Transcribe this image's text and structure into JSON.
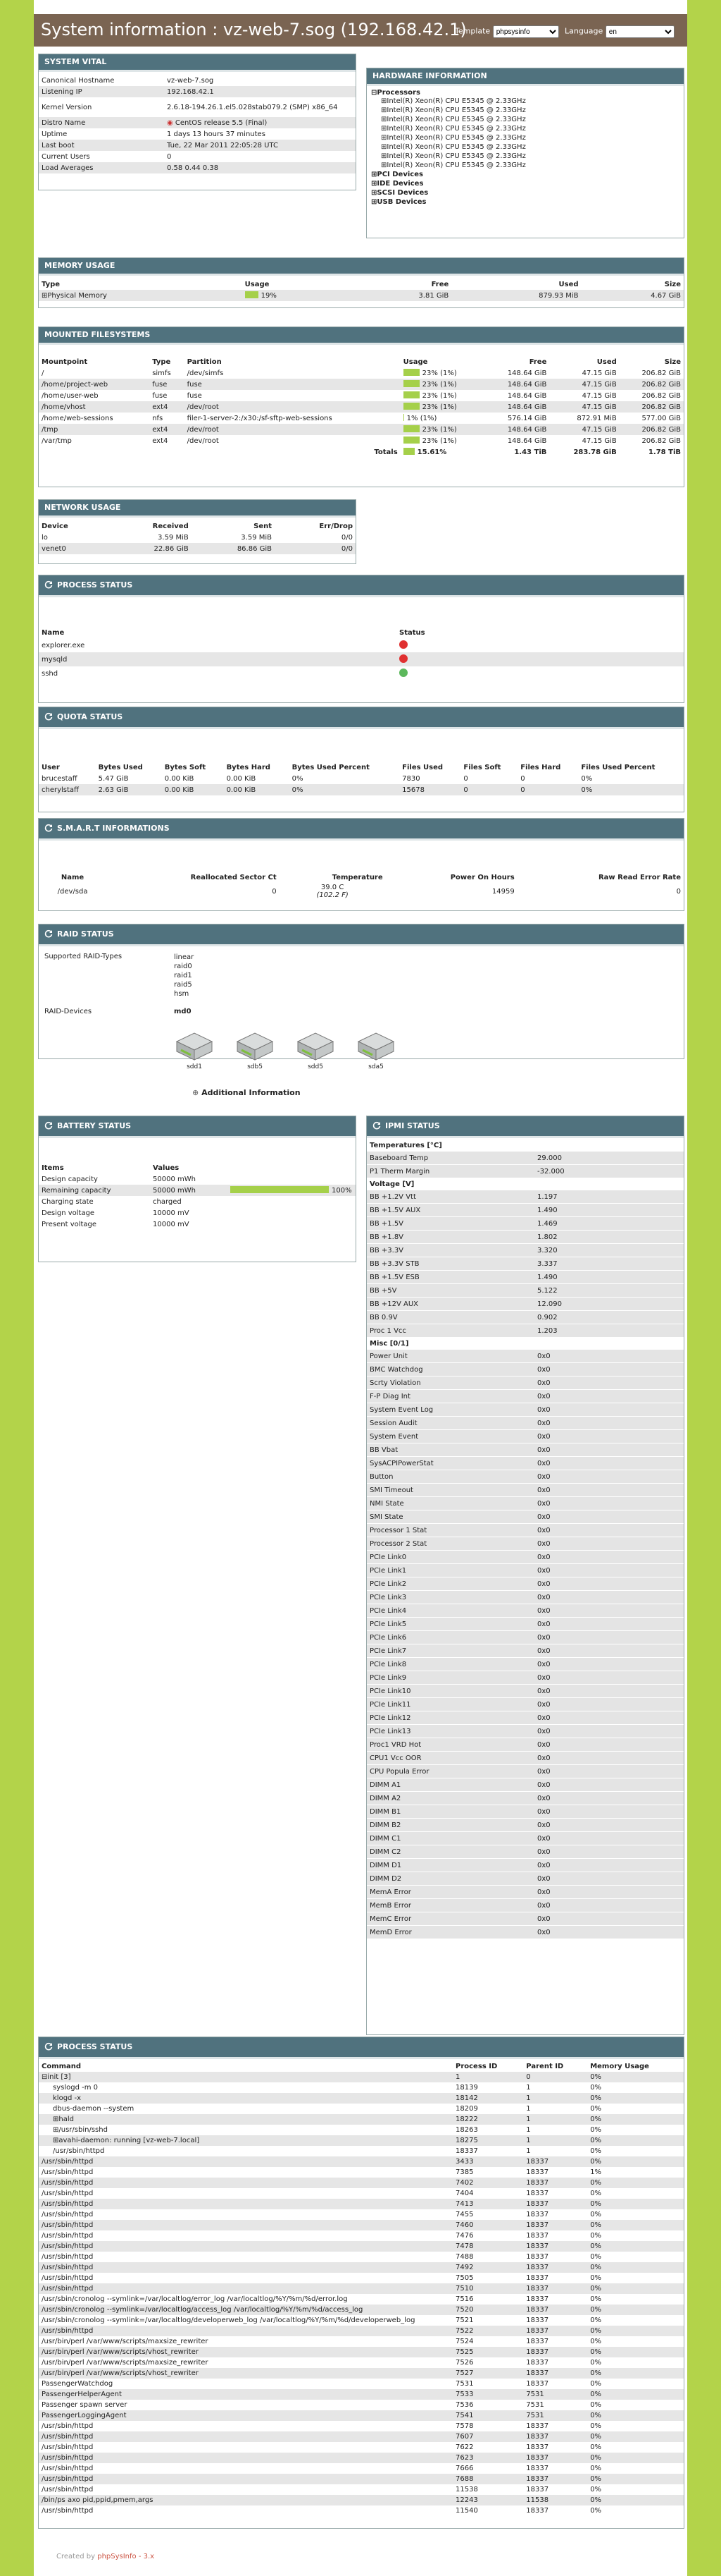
{
  "header": {
    "title": "System information : vz-web-7.sog (192.168.42.1)",
    "template_label": "Template",
    "template_value": "phpsysinfo",
    "language_label": "Language",
    "language_value": "en"
  },
  "vital": {
    "title": "SYSTEM VITAL",
    "rows": [
      [
        "Canonical Hostname",
        "vz-web-7.sog"
      ],
      [
        "Listening IP",
        "192.168.42.1"
      ],
      [
        "Kernel Version",
        "2.6.18-194.26.1.el5.028stab079.2 (SMP) x86_64"
      ],
      [
        "Distro Name",
        "CentOS release 5.5 (Final)"
      ],
      [
        "Uptime",
        "1 days 13 hours 37 minutes"
      ],
      [
        "Last boot",
        "Tue, 22 Mar 2011 22:05:28 UTC"
      ],
      [
        "Current Users",
        "0"
      ],
      [
        "Load Averages",
        "0.58 0.44 0.38"
      ]
    ]
  },
  "hardware": {
    "title": "HARDWARE INFORMATION",
    "processors_label": "Processors",
    "cpus": [
      "Intel(R) Xeon(R) CPU E5345 @ 2.33GHz",
      "Intel(R) Xeon(R) CPU E5345 @ 2.33GHz",
      "Intel(R) Xeon(R) CPU E5345 @ 2.33GHz",
      "Intel(R) Xeon(R) CPU E5345 @ 2.33GHz",
      "Intel(R) Xeon(R) CPU E5345 @ 2.33GHz",
      "Intel(R) Xeon(R) CPU E5345 @ 2.33GHz",
      "Intel(R) Xeon(R) CPU E5345 @ 2.33GHz",
      "Intel(R) Xeon(R) CPU E5345 @ 2.33GHz"
    ],
    "buses": [
      "PCI Devices",
      "IDE Devices",
      "SCSI Devices",
      "USB Devices"
    ]
  },
  "memory": {
    "title": "MEMORY USAGE",
    "headers": [
      "Type",
      "Usage",
      "Free",
      "Used",
      "Size"
    ],
    "row": [
      "Physical Memory",
      "19%",
      "3.81 GiB",
      "879.93 MiB",
      "4.67 GiB"
    ],
    "pct": 0.19
  },
  "filesystems": {
    "title": "MOUNTED FILESYSTEMS",
    "headers": [
      "Mountpoint",
      "Type",
      "Partition",
      "Usage",
      "Free",
      "Used",
      "Size"
    ],
    "rows": [
      [
        "/",
        "simfs",
        "/dev/simfs",
        "23% (1%)",
        "148.64 GiB",
        "47.15 GiB",
        "206.82 GiB"
      ],
      [
        "/home/project-web",
        "fuse",
        "fuse",
        "23% (1%)",
        "148.64 GiB",
        "47.15 GiB",
        "206.82 GiB"
      ],
      [
        "/home/user-web",
        "fuse",
        "fuse",
        "23% (1%)",
        "148.64 GiB",
        "47.15 GiB",
        "206.82 GiB"
      ],
      [
        "/home/vhost",
        "ext4",
        "/dev/root",
        "23% (1%)",
        "148.64 GiB",
        "47.15 GiB",
        "206.82 GiB"
      ],
      [
        "/home/web-sessions",
        "nfs",
        "filer-1-server-2:/x30:/sf-sftp-web-sessions",
        "1% (1%)",
        "576.14 GiB",
        "872.91 MiB",
        "577.00 GiB"
      ],
      [
        "/tmp",
        "ext4",
        "/dev/root",
        "23% (1%)",
        "148.64 GiB",
        "47.15 GiB",
        "206.82 GiB"
      ],
      [
        "/var/tmp",
        "ext4",
        "/dev/root",
        "23% (1%)",
        "148.64 GiB",
        "47.15 GiB",
        "206.82 GiB"
      ]
    ],
    "pcts": [
      0.23,
      0.23,
      0.23,
      0.23,
      0.01,
      0.23,
      0.23
    ],
    "totals": [
      "Totals",
      "15.61%",
      "1.43 TiB",
      "283.78 GiB",
      "1.78 TiB"
    ],
    "total_pct": 0.156
  },
  "network": {
    "title": "NETWORK USAGE",
    "headers": [
      "Device",
      "Received",
      "Sent",
      "Err/Drop"
    ],
    "rows": [
      [
        "lo",
        "3.59 MiB",
        "3.59 MiB",
        "0/0"
      ],
      [
        "venet0",
        "22.86 GiB",
        "86.86 GiB",
        "0/0"
      ]
    ]
  },
  "process_status": {
    "title": "PROCESS STATUS",
    "headers": [
      "Name",
      "Status"
    ],
    "rows": [
      {
        "name": "explorer.exe",
        "color": "#e03030"
      },
      {
        "name": "mysqld",
        "color": "#e03030"
      },
      {
        "name": "sshd",
        "color": "#5cb85c"
      }
    ]
  },
  "quota": {
    "title": "QUOTA STATUS",
    "headers": [
      "User",
      "Bytes Used",
      "Bytes Soft",
      "Bytes Hard",
      "Bytes Used Percent",
      "Files Used",
      "Files Soft",
      "Files Hard",
      "Files Used Percent"
    ],
    "rows": [
      [
        "brucestaff",
        "5.47 GiB",
        "0.00 KiB",
        "0.00 KiB",
        "0%",
        "7830",
        "0",
        "0",
        "0%"
      ],
      [
        "cherylstaff",
        "2.63 GiB",
        "0.00 KiB",
        "0.00 KiB",
        "0%",
        "15678",
        "0",
        "0",
        "0%"
      ]
    ]
  },
  "smart": {
    "title": "S.M.A.R.T INFORMATIONS",
    "headers": [
      "Name",
      "Reallocated Sector Ct",
      "Temperature",
      "Power On Hours",
      "Raw Read Error Rate"
    ],
    "row": [
      "/dev/sda",
      "0",
      "39.0 C",
      "14959",
      "0"
    ],
    "temp_f": "(102.2 F)"
  },
  "raid": {
    "title": "RAID STATUS",
    "types_label": "Supported RAID-Types",
    "types": [
      "linear",
      "raid0",
      "raid1",
      "raid5",
      "hsm"
    ],
    "devices_label": "RAID-Devices",
    "device": "md0",
    "drives": [
      "sdd1",
      "sdb5",
      "sdd5",
      "sda5"
    ],
    "additional": "Additional Information"
  },
  "battery": {
    "title": "BATTERY STATUS",
    "headers": [
      "Items",
      "Values"
    ],
    "rows": [
      [
        "Design capacity",
        "50000 mWh"
      ],
      [
        "Remaining capacity",
        "50000 mWh"
      ],
      [
        "Charging state",
        "charged"
      ],
      [
        "Design voltage",
        "10000 mV"
      ],
      [
        "Present voltage",
        "10000 mV"
      ]
    ],
    "remaining_pct": "100%",
    "remaining_frac": 1.0
  },
  "ipmi": {
    "title": "IPMI STATUS",
    "sections": [
      {
        "name": "Temperatures [°C]",
        "rows": [
          [
            "Baseboard Temp",
            "29.000"
          ],
          [
            "P1 Therm Margin",
            "-32.000"
          ]
        ]
      },
      {
        "name": "Voltage [V]",
        "rows": [
          [
            "BB +1.2V Vtt",
            "1.197"
          ],
          [
            "BB +1.5V AUX",
            "1.490"
          ],
          [
            "BB +1.5V",
            "1.469"
          ],
          [
            "BB +1.8V",
            "1.802"
          ],
          [
            "BB +3.3V",
            "3.320"
          ],
          [
            "BB +3.3V STB",
            "3.337"
          ],
          [
            "BB +1.5V ESB",
            "1.490"
          ],
          [
            "BB +5V",
            "5.122"
          ],
          [
            "BB +12V AUX",
            "12.090"
          ],
          [
            "BB 0.9V",
            "0.902"
          ],
          [
            "Proc 1 Vcc",
            "1.203"
          ]
        ]
      },
      {
        "name": "Misc [0/1]",
        "rows": [
          [
            "Power Unit",
            "0x0"
          ],
          [
            "BMC Watchdog",
            "0x0"
          ],
          [
            "Scrty Violation",
            "0x0"
          ],
          [
            "F-P Diag Int",
            "0x0"
          ],
          [
            "System Event Log",
            "0x0"
          ],
          [
            "Session Audit",
            "0x0"
          ],
          [
            "System Event",
            "0x0"
          ],
          [
            "BB Vbat",
            "0x0"
          ],
          [
            "SysACPIPowerStat",
            "0x0"
          ],
          [
            "Button",
            "0x0"
          ],
          [
            "SMI Timeout",
            "0x0"
          ],
          [
            "NMI State",
            "0x0"
          ],
          [
            "SMI State",
            "0x0"
          ],
          [
            "Processor 1 Stat",
            "0x0"
          ],
          [
            "Processor 2 Stat",
            "0x0"
          ],
          [
            "PCIe Link0",
            "0x0"
          ],
          [
            "PCIe Link1",
            "0x0"
          ],
          [
            "PCIe Link2",
            "0x0"
          ],
          [
            "PCIe Link3",
            "0x0"
          ],
          [
            "PCIe Link4",
            "0x0"
          ],
          [
            "PCIe Link5",
            "0x0"
          ],
          [
            "PCIe Link6",
            "0x0"
          ],
          [
            "PCIe Link7",
            "0x0"
          ],
          [
            "PCIe Link8",
            "0x0"
          ],
          [
            "PCIe Link9",
            "0x0"
          ],
          [
            "PCIe Link10",
            "0x0"
          ],
          [
            "PCIe Link11",
            "0x0"
          ],
          [
            "PCIe Link12",
            "0x0"
          ],
          [
            "PCIe Link13",
            "0x0"
          ],
          [
            "Proc1 VRD Hot",
            "0x0"
          ],
          [
            "CPU1 Vcc OOR",
            "0x0"
          ],
          [
            "CPU Popula Error",
            "0x0"
          ],
          [
            "DIMM A1",
            "0x0"
          ],
          [
            "DIMM A2",
            "0x0"
          ],
          [
            "DIMM B1",
            "0x0"
          ],
          [
            "DIMM B2",
            "0x0"
          ],
          [
            "DIMM C1",
            "0x0"
          ],
          [
            "DIMM C2",
            "0x0"
          ],
          [
            "DIMM D1",
            "0x0"
          ],
          [
            "DIMM D2",
            "0x0"
          ],
          [
            "MemA Error",
            "0x0"
          ],
          [
            "MemB Error",
            "0x0"
          ],
          [
            "MemC Error",
            "0x0"
          ],
          [
            "MemD Error",
            "0x0"
          ]
        ]
      }
    ]
  },
  "processes": {
    "title": "PROCESS STATUS",
    "headers": [
      "Command",
      "Process ID",
      "Parent ID",
      "Memory Usage"
    ],
    "rows": [
      [
        "init [3]",
        "1",
        "0",
        "0%"
      ],
      [
        "syslogd -m 0",
        "18139",
        "1",
        "0%"
      ],
      [
        "klogd -x",
        "18142",
        "1",
        "0%"
      ],
      [
        "dbus-daemon --system",
        "18209",
        "1",
        "0%"
      ],
      [
        "hald",
        "18222",
        "1",
        "0%"
      ],
      [
        "/usr/sbin/sshd",
        "18263",
        "1",
        "0%"
      ],
      [
        "avahi-daemon: running [vz-web-7.local]",
        "18275",
        "1",
        "0%"
      ],
      [
        "/usr/sbin/httpd",
        "18337",
        "1",
        "0%"
      ],
      [
        "/usr/sbin/httpd",
        "3433",
        "18337",
        "0%"
      ],
      [
        "/usr/sbin/httpd",
        "7385",
        "18337",
        "1%"
      ],
      [
        "/usr/sbin/httpd",
        "7402",
        "18337",
        "0%"
      ],
      [
        "/usr/sbin/httpd",
        "7404",
        "18337",
        "0%"
      ],
      [
        "/usr/sbin/httpd",
        "7413",
        "18337",
        "0%"
      ],
      [
        "/usr/sbin/httpd",
        "7455",
        "18337",
        "0%"
      ],
      [
        "/usr/sbin/httpd",
        "7460",
        "18337",
        "0%"
      ],
      [
        "/usr/sbin/httpd",
        "7476",
        "18337",
        "0%"
      ],
      [
        "/usr/sbin/httpd",
        "7478",
        "18337",
        "0%"
      ],
      [
        "/usr/sbin/httpd",
        "7488",
        "18337",
        "0%"
      ],
      [
        "/usr/sbin/httpd",
        "7492",
        "18337",
        "0%"
      ],
      [
        "/usr/sbin/httpd",
        "7505",
        "18337",
        "0%"
      ],
      [
        "/usr/sbin/httpd",
        "7510",
        "18337",
        "0%"
      ],
      [
        "/usr/sbin/cronolog --symlink=/var/localtlog/error_log /var/localtlog/%Y/%m/%d/error.log",
        "7516",
        "18337",
        "0%"
      ],
      [
        "/usr/sbin/cronolog --symlink=/var/localtlog/access_log /var/localtlog/%Y/%m/%d/access_log",
        "7520",
        "18337",
        "0%"
      ],
      [
        "/usr/sbin/cronolog --symlink=/var/localtlog/developerweb_log /var/localtlog/%Y/%m/%d/developerweb_log",
        "7521",
        "18337",
        "0%"
      ],
      [
        "/usr/sbin/httpd",
        "7522",
        "18337",
        "0%"
      ],
      [
        "/usr/bin/perl /var/www/scripts/maxsize_rewriter",
        "7524",
        "18337",
        "0%"
      ],
      [
        "/usr/bin/perl /var/www/scripts/vhost_rewriter",
        "7525",
        "18337",
        "0%"
      ],
      [
        "/usr/bin/perl /var/www/scripts/maxsize_rewriter",
        "7526",
        "18337",
        "0%"
      ],
      [
        "/usr/bin/perl /var/www/scripts/vhost_rewriter",
        "7527",
        "18337",
        "0%"
      ],
      [
        "PassengerWatchdog",
        "7531",
        "18337",
        "0%"
      ],
      [
        "PassengerHelperAgent",
        "7533",
        "7531",
        "0%"
      ],
      [
        "Passenger spawn server",
        "7536",
        "7531",
        "0%"
      ],
      [
        "PassengerLoggingAgent",
        "7541",
        "7531",
        "0%"
      ],
      [
        "/usr/sbin/httpd",
        "7578",
        "18337",
        "0%"
      ],
      [
        "/usr/sbin/httpd",
        "7607",
        "18337",
        "0%"
      ],
      [
        "/usr/sbin/httpd",
        "7622",
        "18337",
        "0%"
      ],
      [
        "/usr/sbin/httpd",
        "7623",
        "18337",
        "0%"
      ],
      [
        "/usr/sbin/httpd",
        "7666",
        "18337",
        "0%"
      ],
      [
        "/usr/sbin/httpd",
        "7688",
        "18337",
        "0%"
      ],
      [
        "/usr/sbin/httpd",
        "11538",
        "18337",
        "0%"
      ],
      [
        "/bin/ps axo pid,ppid,pmem,args",
        "12243",
        "11538",
        "0%"
      ],
      [
        "/usr/sbin/httpd",
        "11540",
        "18337",
        "0%"
      ]
    ]
  },
  "footer": {
    "prefix": "Created by",
    "link": "phpSysInfo - 3.x"
  }
}
